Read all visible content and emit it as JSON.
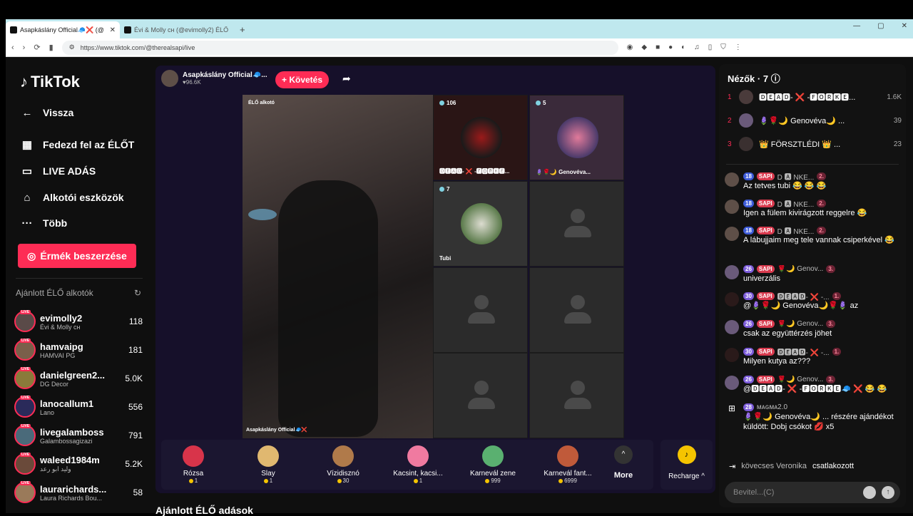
{
  "browser": {
    "tabs": [
      {
        "title": "Asapkáslány Official🧢❌ (@"
      },
      {
        "title": "Évi & Molly ᴄʜ (@evimolly2) ÉLŐ adá"
      }
    ],
    "new_tab": "+",
    "url": "https://www.tiktok.com/@therealsapi/live",
    "win_min": "—",
    "win_max": "▢",
    "win_close": "✕"
  },
  "sidebar": {
    "logo": "TikTok",
    "back": "Vissza",
    "nav": [
      "Fedezd fel az ÉLŐT",
      "LIVE ADÁS",
      "Alkotói eszközök",
      "Több"
    ],
    "coins_button": "Érmék beszerzése",
    "recommended_title": "Ajánlott ÉLŐ alkotók",
    "creators": [
      {
        "name": "evimolly2",
        "sub": "Évi & Molly ᴄʜ",
        "viewers": "118"
      },
      {
        "name": "hamvaipg",
        "sub": "HAMVAI PG",
        "viewers": "181"
      },
      {
        "name": "danielgreen2...",
        "sub": "DG Decor",
        "viewers": "5.0K"
      },
      {
        "name": "lanocallum1",
        "sub": "Lano",
        "viewers": "556"
      },
      {
        "name": "livegalamboss",
        "sub": "Galambossagizazi",
        "viewers": "791"
      },
      {
        "name": "waleed1984m",
        "sub": "وليد ابو رعد",
        "viewers": "5.2K"
      },
      {
        "name": "laurarichards...",
        "sub": "Laura Richards Bou...",
        "viewers": "58"
      }
    ]
  },
  "stream": {
    "host_name": "Asapkáslány Official🧢...",
    "host_likes": "♥96.6K",
    "follow": "+ Követés",
    "main_label": "ÉLŐ alkotó",
    "main_bottom": "Asapkáslány Official🧢❌",
    "guests": [
      {
        "count": "106",
        "name": "🅳🅴🅰🅳- ❌ -🅵🅾🆁🅺🅴..."
      },
      {
        "count": "5",
        "name": "🪻🌹🌙 Genovéva..."
      },
      {
        "count": "7",
        "name": "Tubi"
      }
    ],
    "gifts": [
      {
        "name": "Rózsa",
        "price": "1"
      },
      {
        "name": "Slay",
        "price": "1"
      },
      {
        "name": "Vízidisznó",
        "price": "30"
      },
      {
        "name": "Kacsint, kacsi...",
        "price": "1"
      },
      {
        "name": "Karnevál zene",
        "price": "999"
      },
      {
        "name": "Karnevál fant...",
        "price": "6999"
      }
    ],
    "more": "More",
    "recharge": "Recharge ^",
    "bottom_heading": "Ajánlott ÉLŐ adások"
  },
  "chat": {
    "viewers_title": "Nézők · 7",
    "top_viewers": [
      {
        "rank": "1",
        "name": "🅳🅴🅰🅳- ❌ -🅵🅾🆁🅺🅴...",
        "score": "1.6K"
      },
      {
        "rank": "2",
        "name": "🪻🌹🌙 Genovéva🌙 ...",
        "score": "39"
      },
      {
        "rank": "3",
        "name": "👑 FÖRSZTLÉDI 👑 ...",
        "score": "23"
      }
    ],
    "messages": [
      {
        "lvl": "18",
        "user": "D 🅰 NKE...",
        "rank": "2.",
        "text": "Az tetves tubi 😂 😂 😂"
      },
      {
        "lvl": "18",
        "user": "D 🅰 NKE...",
        "rank": "2.",
        "text": "Igen a fülem kivirágzott reggelre 😂"
      },
      {
        "lvl": "18",
        "user": "D 🅰 NKE...",
        "rank": "2.",
        "text": "A lábujjaim meg tele vannak csiperkével 😂"
      },
      {
        "lvl": "26",
        "user": "🌹🌙 Genov...",
        "rank": "3.",
        "text": "univerzális"
      },
      {
        "lvl": "30",
        "user": "🅳🅴🅰🅳- ❌ -...",
        "rank": "1.",
        "text": "@🪻🌹🌙 Genovéva🌙🌹🪻 az"
      },
      {
        "lvl": "26",
        "user": "🌹🌙 Genov...",
        "rank": "3.",
        "text": "csak az együttérzés jöhet"
      },
      {
        "lvl": "30",
        "user": "🅳🅴🅰🅳- ❌ -...",
        "rank": "1.",
        "text": "Milyen kutya az???"
      },
      {
        "lvl": "26",
        "user": "🌹🌙 Genov...",
        "rank": "3.",
        "text": "@🅳🅴🅰🅳- ❌ -🅵🅾🆁🅺🅴🧢 ❌ 😂 😂"
      },
      {
        "lvl": "28",
        "user": "ᴍᴀɢᴍᴀ2.0",
        "rank": "",
        "text": "🪻🌹🌙 Genovéva🌙 ... részére ajándékot küldött: Dobj csókot 💋 x5"
      }
    ],
    "sapi_badge": "SAPI",
    "join_user": "kövecses Veronika",
    "join_text": "csatlakozott",
    "input_placeholder": "Bevitel...(C)"
  }
}
